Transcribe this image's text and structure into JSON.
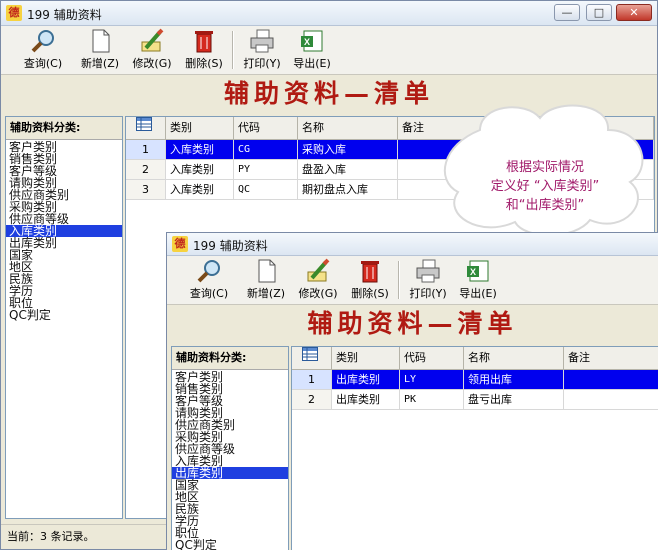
{
  "window_back": {
    "title": "199 辅助资料",
    "app_icon": "德",
    "banner": "辅助资料—清单",
    "toolbar": {
      "query": "查询(C)",
      "add": "新增(Z)",
      "edit": "修改(G)",
      "delete": "删除(S)",
      "print": "打印(Y)",
      "export": "导出(E)"
    },
    "sidebar_title": "辅助资料分类:",
    "categories": [
      "客户类别",
      "销售类别",
      "客户等级",
      "请购类别",
      "供应商类别",
      "采购类别",
      "供应商等级",
      "入库类别",
      "出库类别",
      "国家",
      "地区",
      "民族",
      "学历",
      "职位",
      "QC判定"
    ],
    "selected_category": "入库类别",
    "columns": [
      "类别",
      "代码",
      "名称",
      "备注"
    ],
    "rows": [
      {
        "no": "1",
        "category": "入库类别",
        "code": "CG",
        "name": "采购入库",
        "remark": ""
      },
      {
        "no": "2",
        "category": "入库类别",
        "code": "PY",
        "name": "盘盈入库",
        "remark": ""
      },
      {
        "no": "3",
        "category": "入库类别",
        "code": "QC",
        "name": "期初盘点入库",
        "remark": ""
      }
    ],
    "status": "当前：3 条记录。"
  },
  "window_front": {
    "title": "199 辅助资料",
    "app_icon": "德",
    "banner": "辅助资料—清单",
    "toolbar": {
      "query": "查询(C)",
      "add": "新增(Z)",
      "edit": "修改(G)",
      "delete": "删除(S)",
      "print": "打印(Y)",
      "export": "导出(E)"
    },
    "sidebar_title": "辅助资料分类:",
    "categories": [
      "客户类别",
      "销售类别",
      "客户等级",
      "请购类别",
      "供应商类别",
      "采购类别",
      "供应商等级",
      "入库类别",
      "出库类别",
      "国家",
      "地区",
      "民族",
      "学历",
      "职位",
      "QC判定"
    ],
    "selected_category": "出库类别",
    "columns": [
      "类别",
      "代码",
      "名称",
      "备注"
    ],
    "rows": [
      {
        "no": "1",
        "category": "出库类别",
        "code": "LY",
        "name": "领用出库",
        "remark": ""
      },
      {
        "no": "2",
        "category": "出库类别",
        "code": "PK",
        "name": "盘亏出库",
        "remark": ""
      }
    ]
  },
  "callout": {
    "lines": [
      "根据实际情况",
      "定义好 “入库类别”",
      "和“出库类别”"
    ]
  },
  "colors": {
    "banner_red": "#b01a12",
    "selection_blue": "#0000ee",
    "callout_text": "#a11a6a"
  }
}
